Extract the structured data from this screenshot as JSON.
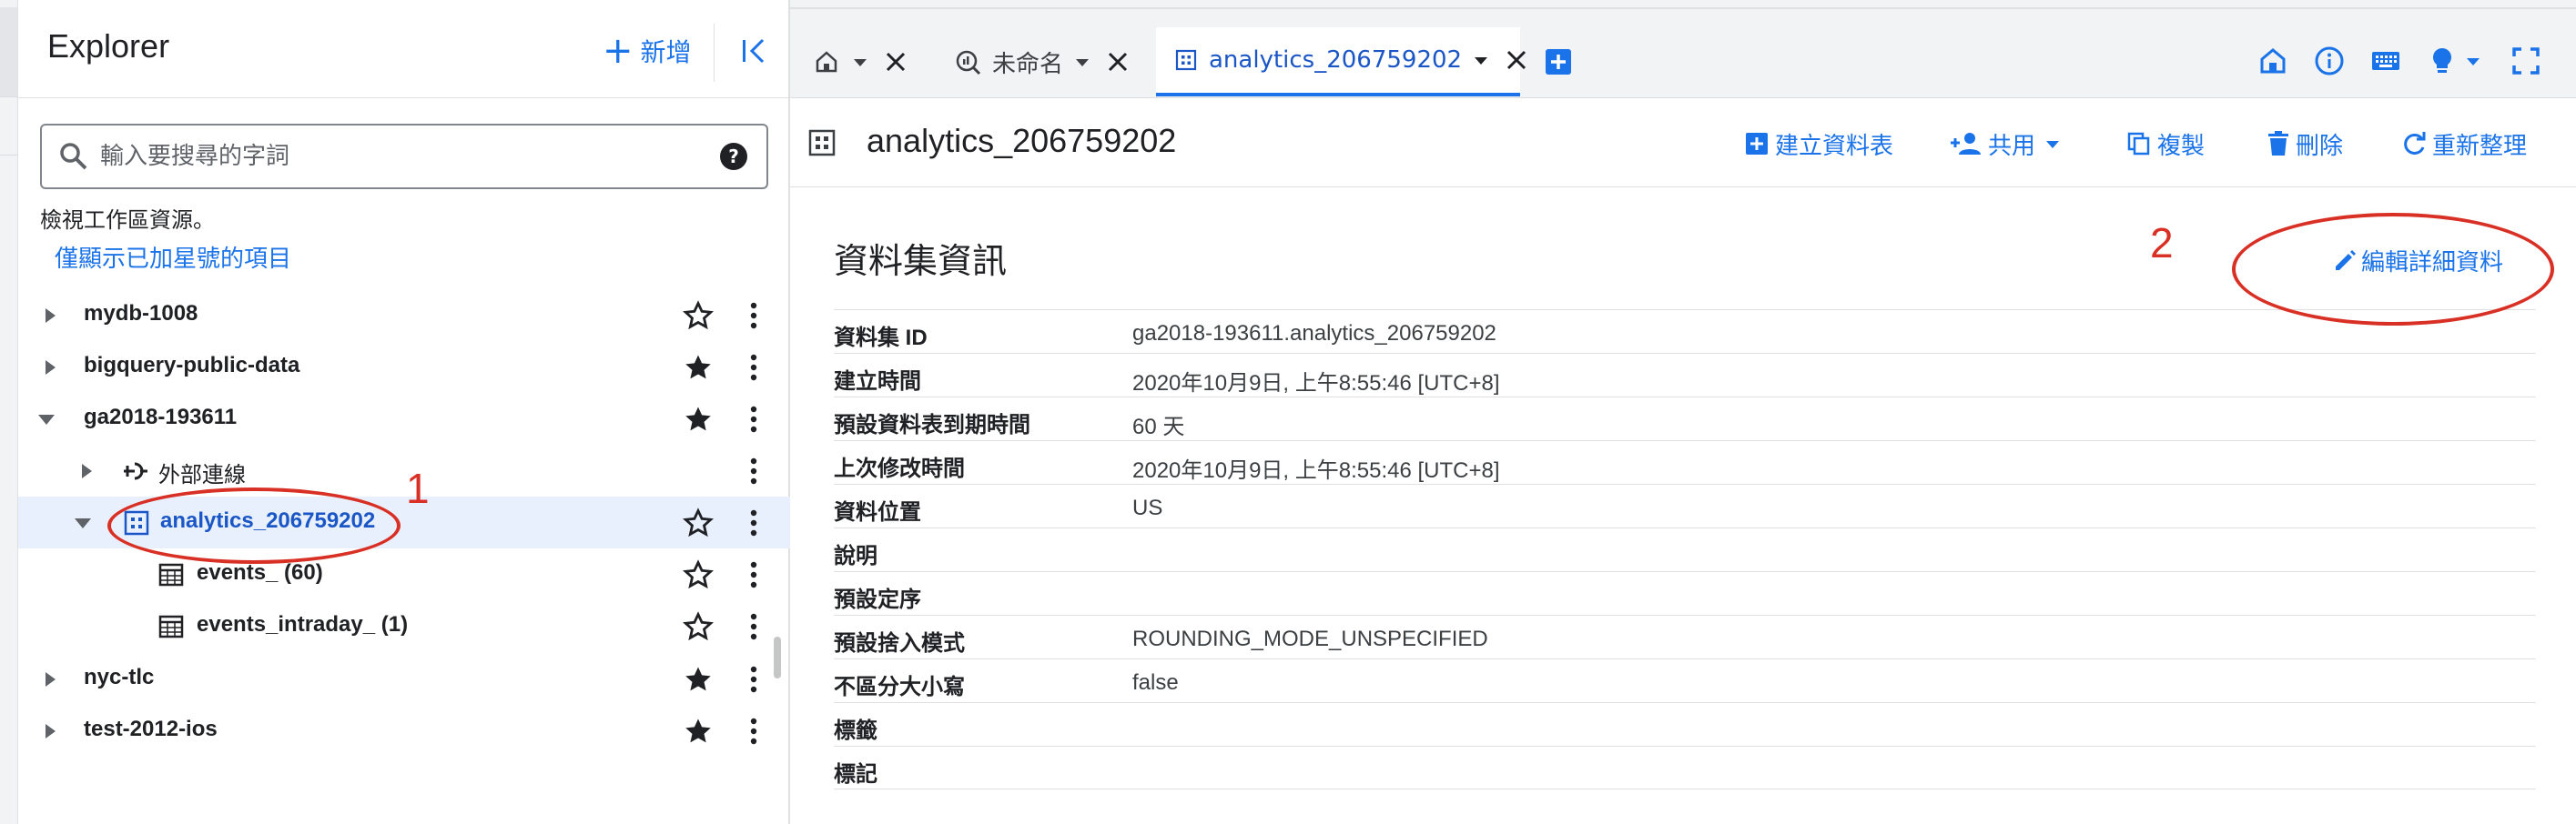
{
  "explorer": {
    "title": "Explorer",
    "add_label": "新增",
    "search_placeholder": "輸入要搜尋的字詞",
    "workspace_note": "檢視工作區資源。",
    "starred_link": "僅顯示已加星號的項目",
    "tree": [
      {
        "label": "mydb-1008",
        "starred": false
      },
      {
        "label": "bigquery-public-data",
        "starred": true
      },
      {
        "label": "ga2018-193611",
        "starred": true,
        "expanded": true
      },
      {
        "label": "外部連線"
      },
      {
        "label": "analytics_206759202",
        "starred": false,
        "selected": true,
        "expanded": true
      },
      {
        "label": "events_ (60)",
        "starred": false
      },
      {
        "label": "events_intraday_ (1)",
        "starred": false
      },
      {
        "label": "nyc-tlc",
        "starred": true
      },
      {
        "label": "test-2012-ios",
        "starred": true
      }
    ]
  },
  "tabs": [
    {
      "icon": "home-icon",
      "label": ""
    },
    {
      "icon": "query-icon",
      "label": "未命名"
    },
    {
      "icon": "dataset-icon",
      "label": "analytics_206759202",
      "active": true
    }
  ],
  "toolbar": {
    "title": "analytics_206759202",
    "create_table": "建立資料表",
    "share": "共用",
    "copy": "複製",
    "delete": "刪除",
    "refresh": "重新整理"
  },
  "dataset_info": {
    "section_title": "資料集資訊",
    "edit_label": "編輯詳細資料",
    "rows": [
      {
        "key": "資料集 ID",
        "value": "ga2018-193611.analytics_206759202"
      },
      {
        "key": "建立時間",
        "value": "2020年10月9日, 上午8:55:46 [UTC+8]"
      },
      {
        "key": "預設資料表到期時間",
        "value": "60 天"
      },
      {
        "key": "上次修改時間",
        "value": "2020年10月9日, 上午8:55:46 [UTC+8]"
      },
      {
        "key": "資料位置",
        "value": "US"
      },
      {
        "key": "說明",
        "value": ""
      },
      {
        "key": "預設定序",
        "value": ""
      },
      {
        "key": "預設捨入模式",
        "value": "ROUNDING_MODE_UNSPECIFIED"
      },
      {
        "key": "不區分大小寫",
        "value": "false"
      },
      {
        "key": "標籤",
        "value": ""
      },
      {
        "key": "標記",
        "value": ""
      }
    ]
  },
  "annotations": {
    "marker_1": "1",
    "marker_2": "2",
    "color": "#d93025"
  },
  "colors": {
    "accent": "#1a73e8",
    "selected_row": "#e8f0fe"
  }
}
